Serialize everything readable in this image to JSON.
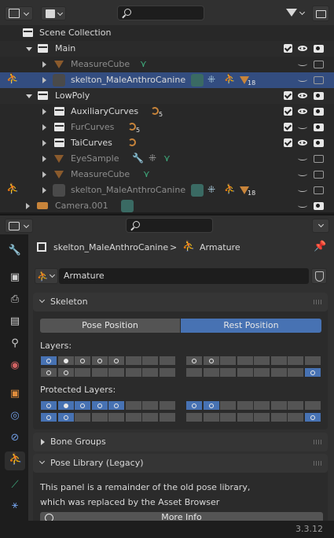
{
  "outliner": {
    "header": {
      "display_mode_icon": "outliner-display-icon",
      "filter_icon": "filter-icon",
      "new_collection_icon": "new-collection-icon",
      "search_placeholder": ""
    },
    "rows": [
      {
        "label": "Scene Collection",
        "type": "scene-collection"
      },
      {
        "label": "Main",
        "type": "collection"
      },
      {
        "label": "MeasureCube",
        "type": "object",
        "dimmed": true
      },
      {
        "label": "skelton_MaleAnthroCanine",
        "type": "armature",
        "selected": true,
        "count": "18"
      },
      {
        "label": "LowPoly",
        "type": "collection"
      },
      {
        "label": "AuxiliaryCurves",
        "type": "collection",
        "count": "5"
      },
      {
        "label": "FurCurves",
        "type": "collection",
        "dimmed": true,
        "count": "5"
      },
      {
        "label": "TaiCurves",
        "type": "collection"
      },
      {
        "label": "EyeSample",
        "type": "object",
        "dimmed": true
      },
      {
        "label": "MeasureCube",
        "type": "object",
        "dimmed": true
      },
      {
        "label": "skelton_MaleAnthroCanine",
        "type": "armature",
        "dimmed": true,
        "count": "18"
      },
      {
        "label": "Camera.001",
        "type": "camera",
        "dimmed": true
      }
    ]
  },
  "properties": {
    "breadcrumb": {
      "object": "skelton_MaleAnthroCanine",
      "separator": ">",
      "data": "Armature"
    },
    "datablock_name": "Armature",
    "skeleton": {
      "title": "Skeleton",
      "pose_position_label": "Pose Position",
      "rest_position_label": "Rest Position",
      "active_position": "Rest Position",
      "layers_label": "Layers:",
      "protected_layers_label": "Protected Layers:"
    },
    "bone_groups": {
      "title": "Bone Groups"
    },
    "pose_library": {
      "title": "Pose Library (Legacy)",
      "text_line1": "This panel is a remainder of the old pose library,",
      "text_line2": "which was replaced by the Asset Browser",
      "more_info_label": "More Info"
    }
  },
  "status_bar": {
    "version": "3.3.12"
  },
  "colors": {
    "accent": "#4772b3",
    "selected_row": "#334d80",
    "armature_green": "#3fae7e",
    "object_orange": "#c8843a"
  }
}
